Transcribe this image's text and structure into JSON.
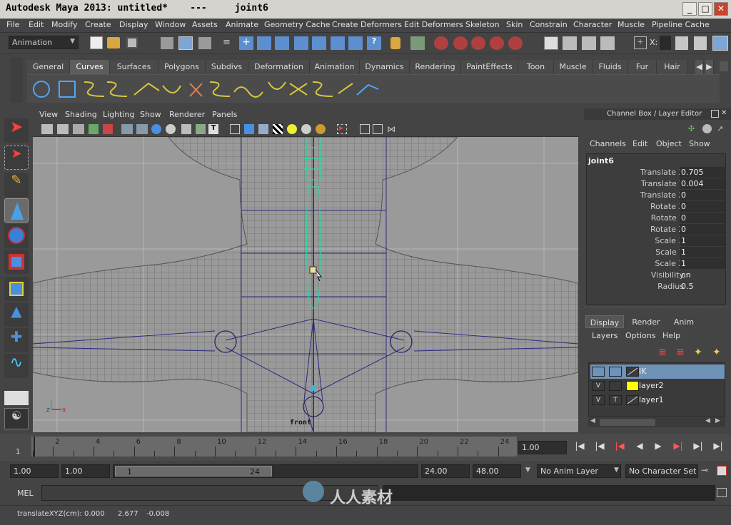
{
  "window": {
    "title": "Autodesk Maya 2013: untitled*    ---     joint6",
    "minimize": "_",
    "maximize": "□",
    "close": "✕"
  },
  "menubar": [
    "File",
    "Edit",
    "Modify",
    "Create",
    "Display",
    "Window",
    "Assets",
    "Animate",
    "Geometry Cache",
    "Create Deformers",
    "Edit Deformers",
    "Skeleton",
    "Skin",
    "Constrain",
    "Character",
    "Muscle",
    "Pipeline Cache"
  ],
  "status_line": {
    "mode": "Animation",
    "axis_label": "X:"
  },
  "shelf": {
    "tabs": [
      "General",
      "Curves",
      "Surfaces",
      "Polygons",
      "Subdivs",
      "Deformation",
      "Animation",
      "Dynamics",
      "Rendering",
      "PaintEffects",
      "Toon",
      "Muscle",
      "Fluids",
      "Fur",
      "Hair"
    ],
    "active_tab": "Curves"
  },
  "viewport": {
    "menu": [
      "View",
      "Shading",
      "Lighting",
      "Show",
      "Renderer",
      "Panels"
    ],
    "camera_label": "front",
    "axis_z": "z",
    "axis_x": "x"
  },
  "channel_box": {
    "title": "Channel Box / Layer Editor",
    "menu": [
      "Channels",
      "Edit",
      "Object",
      "Show"
    ],
    "object": "joint6",
    "channels": [
      {
        "name": "Translate X",
        "value": "0.705"
      },
      {
        "name": "Translate Y",
        "value": "0.004"
      },
      {
        "name": "Translate Z",
        "value": "0"
      },
      {
        "name": "Rotate X",
        "value": "0"
      },
      {
        "name": "Rotate Y",
        "value": "0"
      },
      {
        "name": "Rotate Z",
        "value": "0"
      },
      {
        "name": "Scale X",
        "value": "1"
      },
      {
        "name": "Scale Y",
        "value": "1"
      },
      {
        "name": "Scale Z",
        "value": "1"
      },
      {
        "name": "Visibility",
        "value": "on"
      },
      {
        "name": "Radius",
        "value": "0.5"
      }
    ]
  },
  "layer_editor": {
    "tabs": [
      "Display",
      "Render",
      "Anim"
    ],
    "active_tab": "Display",
    "menu": [
      "Layers",
      "Options",
      "Help"
    ],
    "layers": [
      {
        "v": "",
        "t": "",
        "name": "IK",
        "color": "#3a3a3a",
        "selected": true
      },
      {
        "v": "V",
        "t": "",
        "name": "layer2",
        "color": "#ffff00",
        "selected": false
      },
      {
        "v": "V",
        "t": "T",
        "name": "layer1",
        "color": "#3a3a3a",
        "selected": false
      }
    ]
  },
  "timeline": {
    "ticks": [
      "2",
      "4",
      "6",
      "8",
      "10",
      "12",
      "14",
      "16",
      "18",
      "20",
      "22",
      "24"
    ],
    "start_tick": "1",
    "current_time": "1.00"
  },
  "range": {
    "start": "1.00",
    "playback_start": "1.00",
    "slider_start": "1",
    "slider_end": "24",
    "playback_end": "24.00",
    "end": "48.00",
    "anim_layer": "No Anim Layer",
    "character_set": "No Character Set"
  },
  "command_line": {
    "label": "MEL",
    "value": ""
  },
  "help_line": {
    "text": "translateXYZ(cm):",
    "x": "0.000",
    "y": "2.677",
    "z": "-0.008"
  },
  "watermark": "人人素材"
}
